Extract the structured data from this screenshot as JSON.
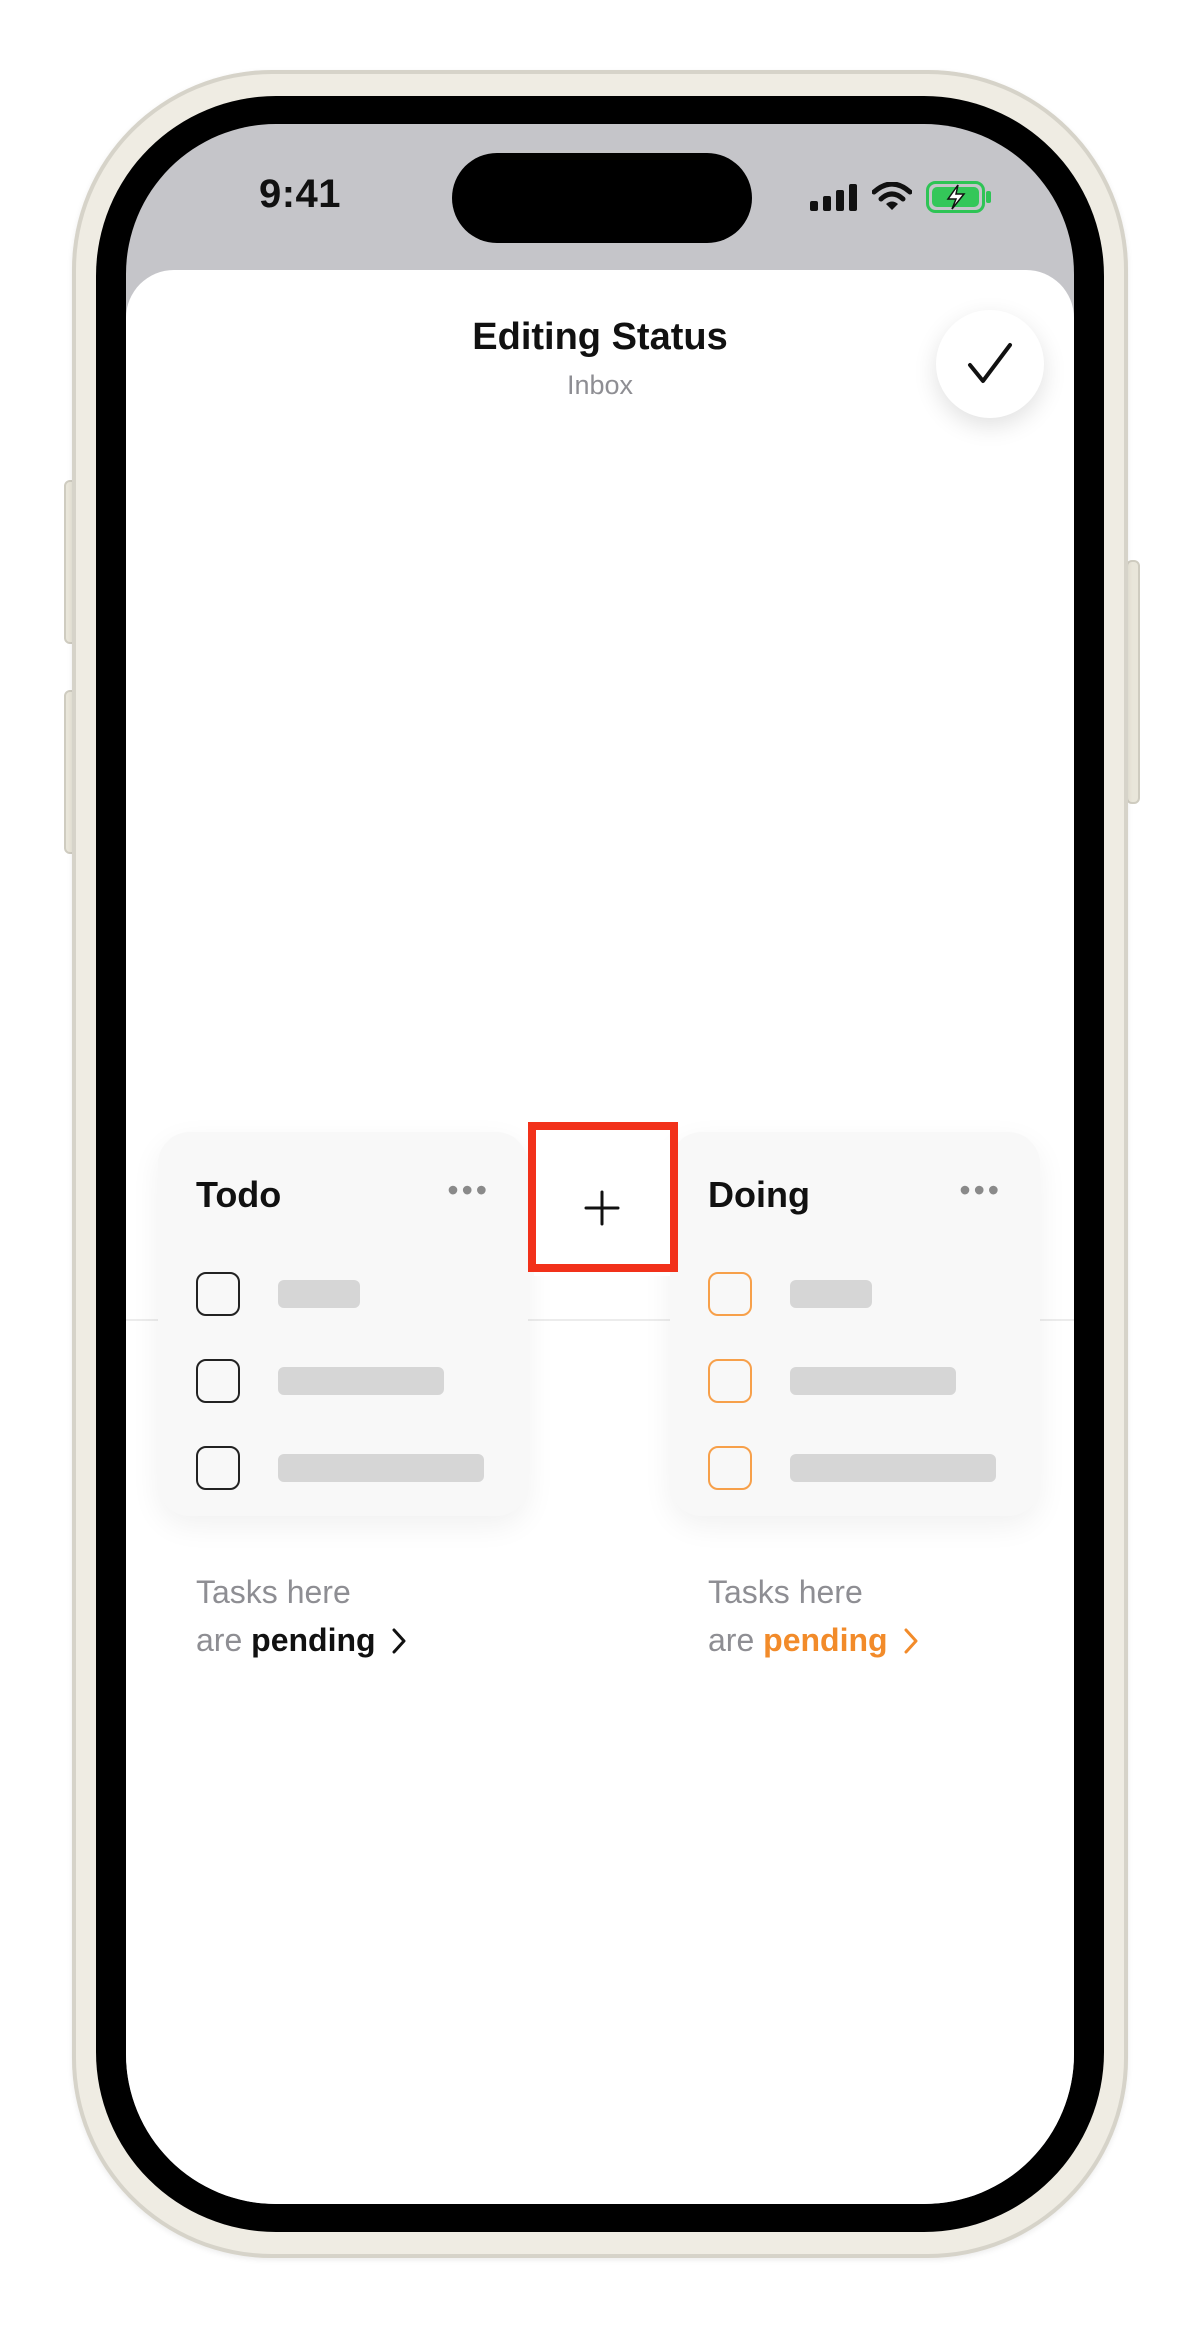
{
  "status_bar": {
    "time": "9:41"
  },
  "sheet": {
    "title": "Editing Status",
    "subtitle": "Inbox",
    "done_icon": "checkmark-icon"
  },
  "columns": [
    {
      "name": "Todo",
      "more_icon": "ellipsis-icon",
      "caption_line1": "Tasks here",
      "caption_prefix": "are",
      "caption_status": "pending",
      "accent": "#111111"
    },
    {
      "name": "Doing",
      "more_icon": "ellipsis-icon",
      "caption_line1": "Tasks here",
      "caption_prefix": "are",
      "caption_status": "pending",
      "accent": "#f28b2a"
    }
  ],
  "add_status": {
    "icon": "plus-icon",
    "highlight_color": "#f2311a"
  }
}
